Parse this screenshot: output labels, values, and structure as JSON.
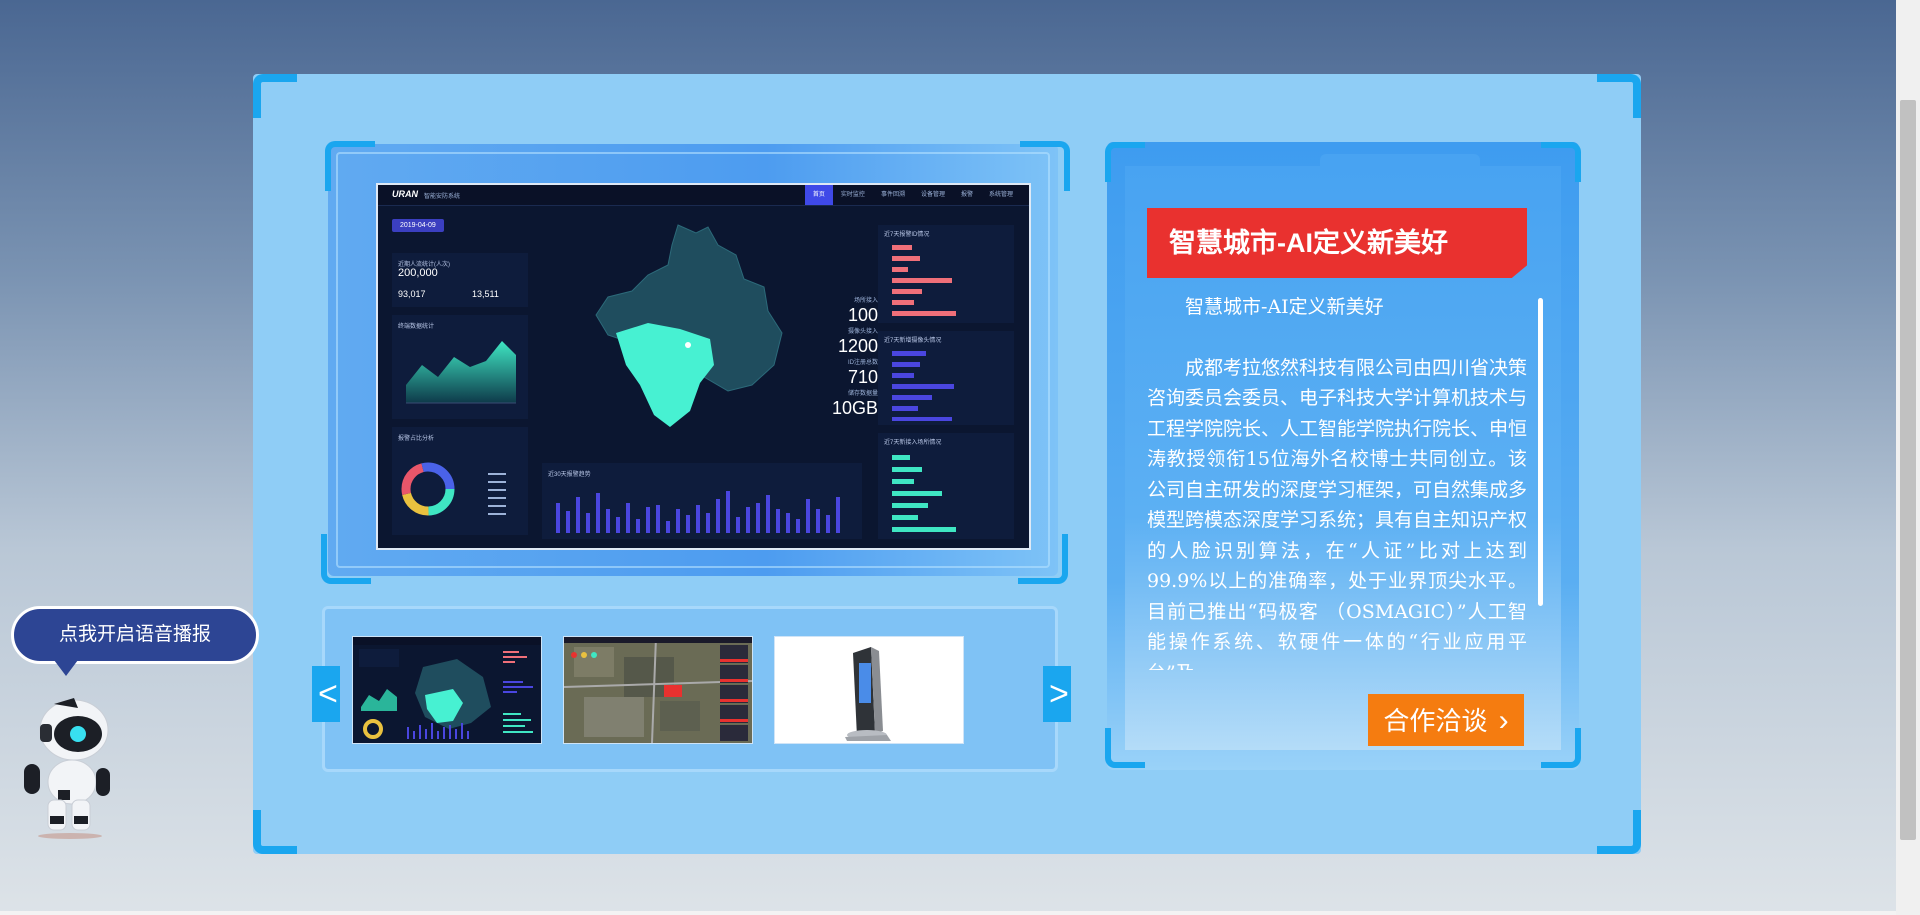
{
  "voice": {
    "label": "点我开启语音播报"
  },
  "preview": {
    "dashboard": {
      "logo": "URAN",
      "subtitle": "智能安防系统",
      "nav": [
        "首页",
        "实时监控",
        "事件回溯",
        "设备管理",
        "报警",
        "系统管理"
      ],
      "date": "2019-04-09",
      "total_label": "近期人流统计(人次)",
      "total_value": "200,000",
      "sub_left_value": "93,017",
      "sub_right_value": "13,511",
      "area_chart_title": "终端数据统计",
      "donut_title": "报警占比分析",
      "bars_title": "近30天报警趋势",
      "right_titles": [
        "近7天报警ID情况",
        "近7天新增摄像头情况",
        "近7天新接入场所情况"
      ],
      "stats": [
        {
          "label": "场所接入",
          "value": "100"
        },
        {
          "label": "摄像头接入",
          "value": "1200"
        },
        {
          "label": "ID注册总数",
          "value": "710"
        },
        {
          "label": "储存数据量",
          "value": "10GB"
        }
      ]
    }
  },
  "carousel": {
    "prev_label": "<",
    "next_label": ">"
  },
  "info": {
    "title": "智慧城市-AI定义新美好",
    "subtitle": "智慧城市-AI定义新美好",
    "body": "成都考拉悠然科技有限公司由四川省决策咨询委员会委员、电子科技大学计算机技术与工程学院院长、人工智能学院执行院长、申恒涛教授领衔15位海外名校博士共同创立。该公司自主研发的深度学习框架，可自然集成多模型跨模态深度学习系统；具有自主知识产权的人脸识别算法，在“人证”比对上达到99.9%以上的准确率，处于业界顶尖水平。目前已推出“码极客 （OSMAGIC）”人工智能操作系统、软硬件一体的“行业应用平台”及",
    "button": "合作洽谈"
  },
  "colors": {
    "frame": "#8fcdf6",
    "corner": "#1aa6ef",
    "title_banner": "#e9312f",
    "button": "#f57c10",
    "speech": "#2d4594"
  }
}
